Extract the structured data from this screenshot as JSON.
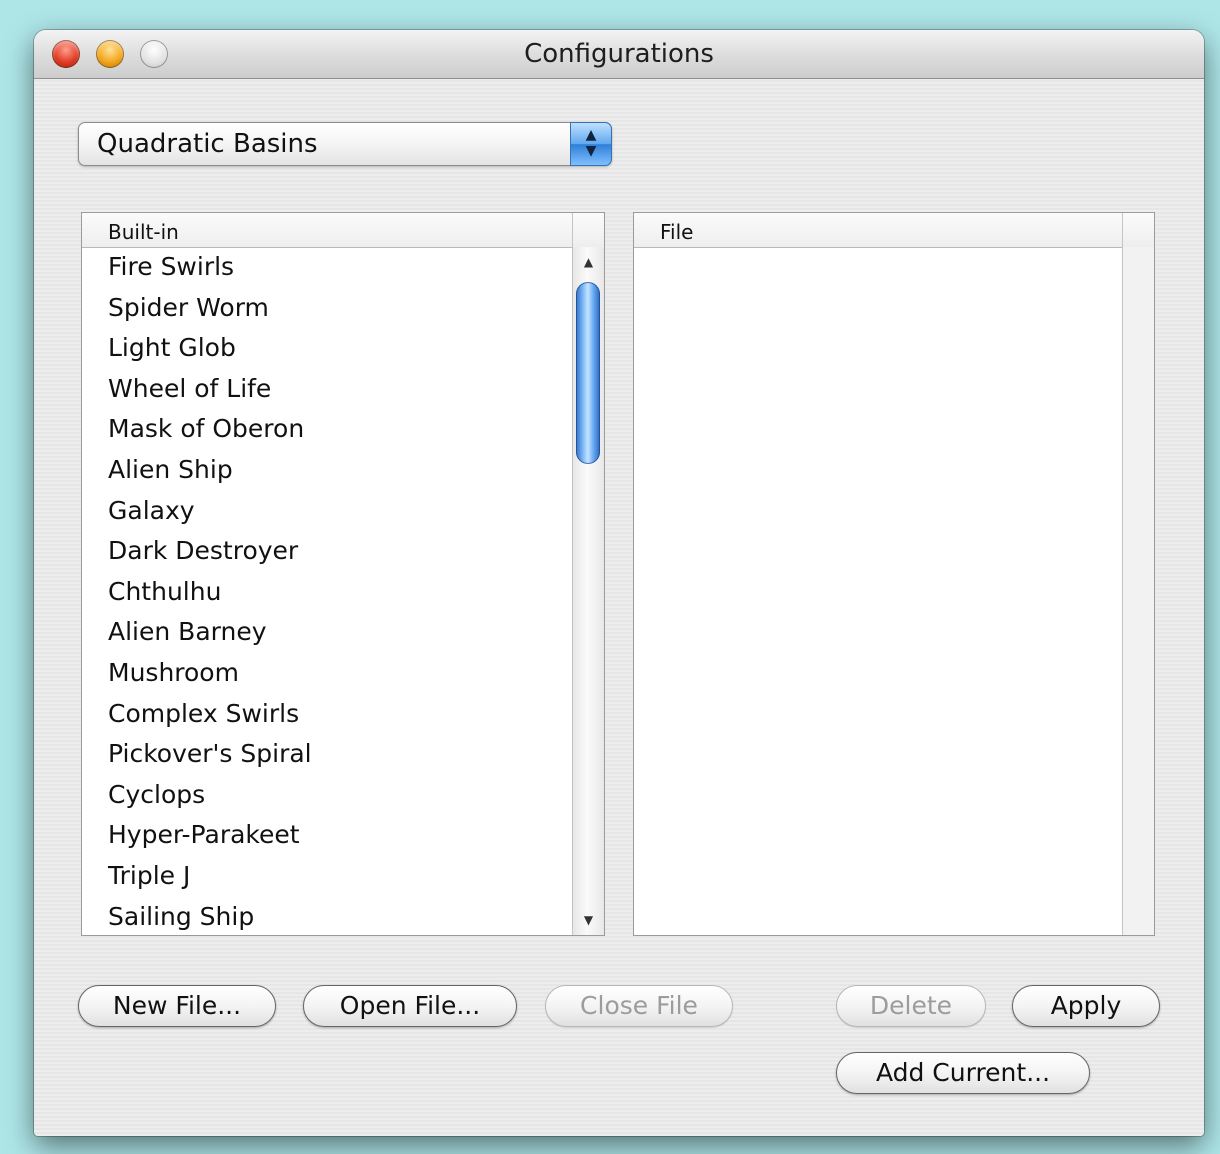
{
  "window": {
    "title": "Configurations"
  },
  "popup": {
    "selected": "Quadratic Basins"
  },
  "builtin_list": {
    "header": "Built-in",
    "items": [
      "Fire Swirls",
      "Spider Worm",
      "Light Glob",
      "Wheel of Life",
      "Mask of Oberon",
      "Alien Ship",
      "Galaxy",
      "Dark Destroyer",
      "Chthulhu",
      "Alien Barney",
      "Mushroom",
      "Complex Swirls",
      "Pickover's Spiral",
      "Cyclops",
      "Hyper-Parakeet",
      "Triple J",
      "Sailing Ship"
    ]
  },
  "file_list": {
    "header": "File",
    "items": []
  },
  "buttons": {
    "new_file": "New File...",
    "open_file": "Open File...",
    "close_file": "Close File",
    "delete": "Delete",
    "apply": "Apply",
    "add_current": "Add Current..."
  }
}
